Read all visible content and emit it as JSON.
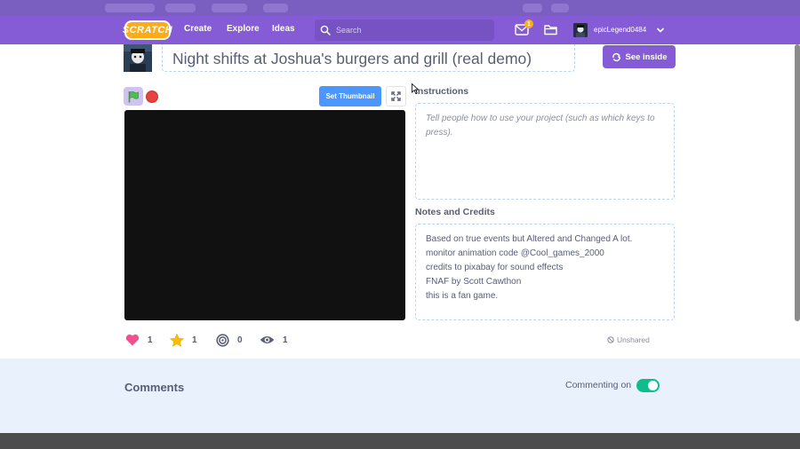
{
  "navbar": {
    "logo": "SCRATCH",
    "links": [
      "Create",
      "Explore",
      "Ideas"
    ],
    "search_placeholder": "Search",
    "message_count": "1",
    "username": "epicLegend0484"
  },
  "project": {
    "title": "Night shifts at Joshua's burgers and grill (real demo)",
    "see_inside_label": "See inside",
    "set_thumbnail_label": "Set Thumbnail",
    "instructions_heading": "Instructions",
    "instructions_placeholder": "Tell people how to use your project (such as which keys to press).",
    "notes_heading": "Notes and Credits",
    "notes_lines": [
      "Based on true events but Altered and Changed A lot.",
      "monitor animation code @Cool_games_2000",
      "credits to pixabay for sound effects",
      "FNAF by Scott Cawthon",
      "this is a fan game."
    ],
    "stats": {
      "loves": "1",
      "favorites": "1",
      "remixes": "0",
      "views": "1"
    },
    "share_status": "Unshared"
  },
  "comments": {
    "title": "Comments",
    "commenting_label": "Commenting on",
    "commenting_enabled": true
  },
  "colors": {
    "navbar": "#855cd6",
    "see_inside": "#855cd6",
    "set_thumbnail": "#4c97ff",
    "stop": "#e6423f",
    "love": "#f0518e",
    "favorite": "#ffbf00",
    "toggle_on": "#0fbd8c",
    "comments_bg": "#e9f1fc"
  }
}
